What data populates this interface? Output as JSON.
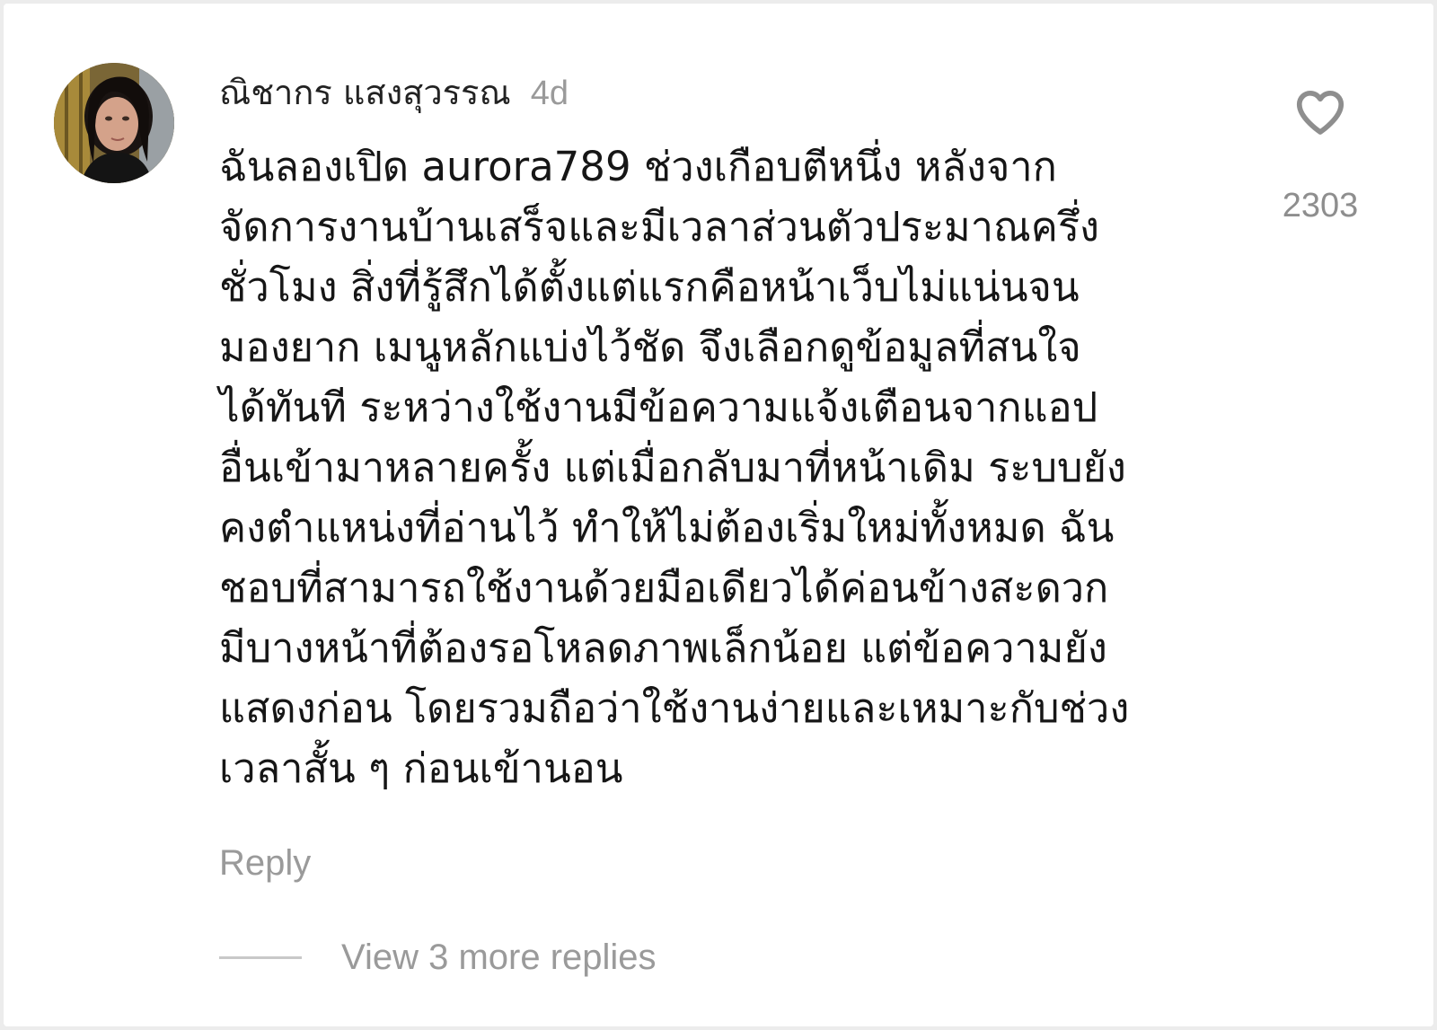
{
  "comment": {
    "author": "ณิชากร แสงสุวรรณ",
    "time_ago": "4d",
    "text": "ฉันลองเปิด aurora789 ช่วงเกือบตีหนึ่ง หลังจาก\nจัดการงานบ้านเสร็จและมีเวลาส่วนตัวประมาณครึ่ง\nชั่วโมง สิ่งที่รู้สึกได้ตั้งแต่แรกคือหน้าเว็บไม่แน่นจน\nมองยาก เมนูหลักแบ่งไว้ชัด จึงเลือกดูข้อมูลที่สนใจ\nได้ทันที ระหว่างใช้งานมีข้อความแจ้งเตือนจากแอป\nอื่นเข้ามาหลายครั้ง แต่เมื่อกลับมาที่หน้าเดิม ระบบยัง\nคงตำแหน่งที่อ่านไว้ ทำให้ไม่ต้องเริ่มใหม่ทั้งหมด ฉัน\nชอบที่สามารถใช้งานด้วยมือเดียวได้ค่อนข้างสะดวก\nมีบางหน้าที่ต้องรอโหลดภาพเล็กน้อย แต่ข้อความยัง\nแสดงก่อน โดยรวมถือว่าใช้งานง่ายและเหมาะกับช่วง\nเวลาสั้น ๆ ก่อนเข้านอน",
    "reply_label": "Reply",
    "view_replies_label": "View 3 more replies",
    "like_count": "2303",
    "like_icon": "heart-outline-icon"
  },
  "colors": {
    "background": "#ffffff",
    "page": "#ececec",
    "primary_text": "#161616",
    "muted_text": "#9a9a9a",
    "icon": "#8e8e8e"
  }
}
